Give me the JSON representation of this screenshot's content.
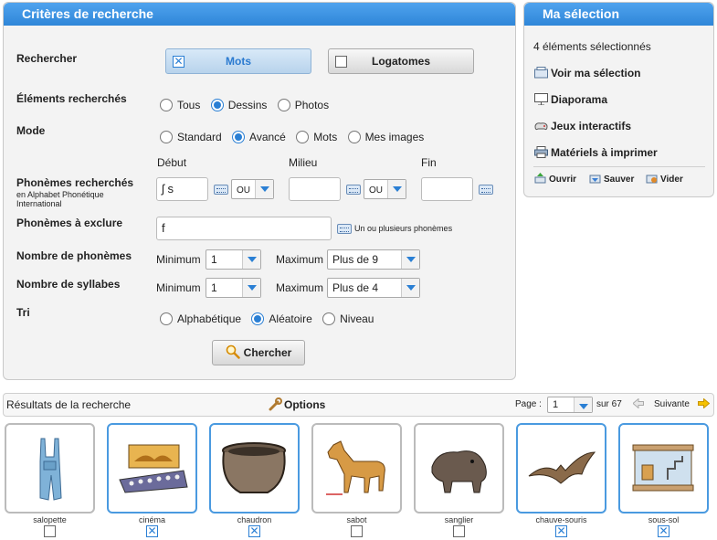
{
  "criteria": {
    "title": "Critères de recherche",
    "search": {
      "label": "Rechercher",
      "mots": "Mots",
      "logatomes": "Logatomes"
    },
    "elements": {
      "label": "Éléments recherchés",
      "options": [
        "Tous",
        "Dessins",
        "Photos"
      ],
      "selected": "Dessins"
    },
    "mode": {
      "label": "Mode",
      "options": [
        "Standard",
        "Avancé",
        "Mots",
        "Mes images"
      ],
      "selected": "Avancé"
    },
    "phonemes": {
      "label": "Phonèmes recherchés",
      "sublabel": "en Alphabet Phonétique International",
      "debut_label": "Début",
      "milieu_label": "Milieu",
      "fin_label": "Fin",
      "debut_value": "ʃ s",
      "milieu_value": "",
      "fin_value": "",
      "op1": "OU",
      "op2": "OU"
    },
    "exclude": {
      "label": "Phonèmes à exclure",
      "value": "f",
      "hint": "Un ou plusieurs phonèmes"
    },
    "nb_phonemes": {
      "label": "Nombre de phonèmes",
      "min_label": "Minimum",
      "min": "1",
      "max_label": "Maximum",
      "max": "Plus de 9"
    },
    "nb_syllabes": {
      "label": "Nombre de syllabes",
      "min_label": "Minimum",
      "min": "1",
      "max_label": "Maximum",
      "max": "Plus de 4"
    },
    "tri": {
      "label": "Tri",
      "options": [
        "Alphabétique",
        "Aléatoire",
        "Niveau"
      ],
      "selected": "Aléatoire"
    },
    "search_button": "Chercher"
  },
  "selection": {
    "title": "Ma sélection",
    "count": "4 éléments sélectionnés",
    "links": [
      "Voir ma sélection",
      "Diaporama",
      "Jeux interactifs",
      "Matériels à imprimer"
    ],
    "actions": [
      "Ouvrir",
      "Sauver",
      "Vider"
    ]
  },
  "results": {
    "title": "Résultats de la recherche",
    "options": "Options",
    "page_label": "Page :",
    "page": "1",
    "total": "sur 67",
    "next": "Suivante",
    "items": [
      {
        "name": "salopette",
        "selected": false
      },
      {
        "name": "cinéma",
        "selected": true
      },
      {
        "name": "chaudron",
        "selected": true
      },
      {
        "name": "sabot",
        "selected": false
      },
      {
        "name": "sanglier",
        "selected": false
      },
      {
        "name": "chauve-souris",
        "selected": true
      },
      {
        "name": "sous-sol",
        "selected": true
      }
    ]
  },
  "colors": {
    "header": "#2f86d8",
    "accent": "#2a7fd4"
  }
}
